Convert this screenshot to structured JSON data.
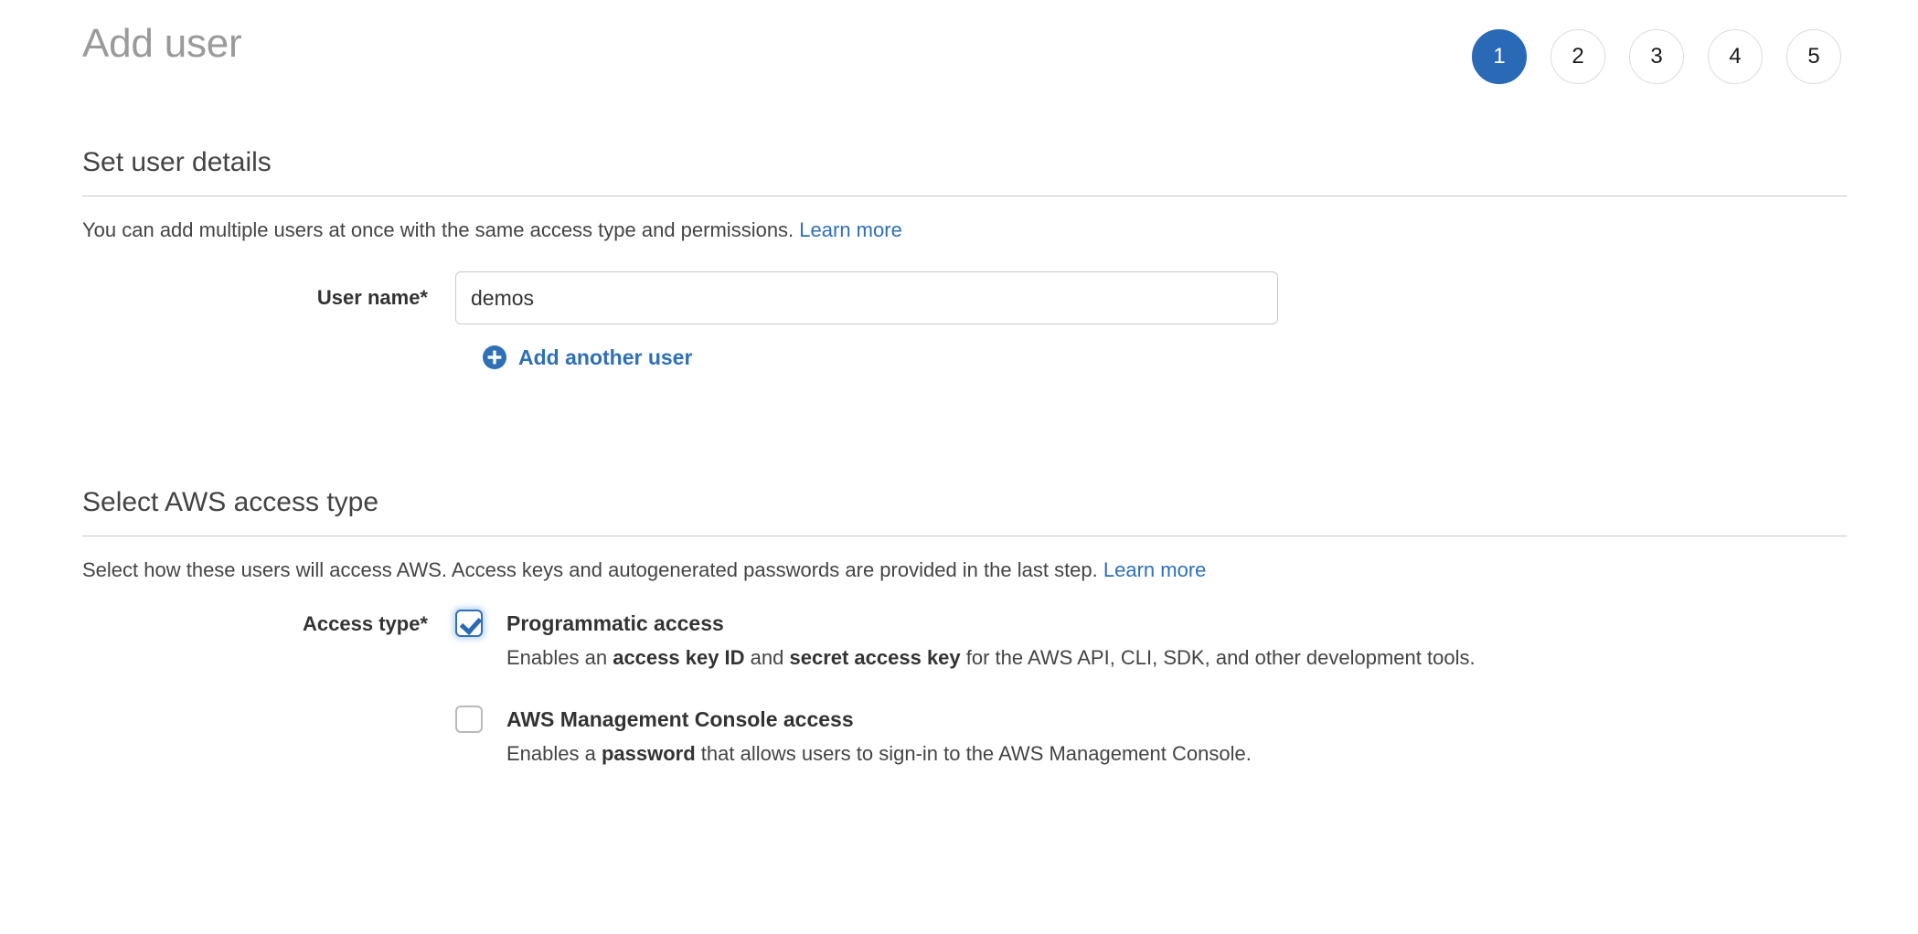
{
  "header": {
    "title": "Add user",
    "steps": [
      {
        "label": "1",
        "active": true
      },
      {
        "label": "2",
        "active": false
      },
      {
        "label": "3",
        "active": false
      },
      {
        "label": "4",
        "active": false
      },
      {
        "label": "5",
        "active": false
      }
    ]
  },
  "colors": {
    "accent_blue": "#2a69b5",
    "link_blue": "#2f6fb5",
    "title_gray": "#9a9a9a",
    "text": "#333333",
    "divider": "#c8c8c8",
    "input_border": "#c9c9c9",
    "checkbox_border": "#b9b9b9"
  },
  "user_details": {
    "section_title": "Set user details",
    "description_text": "You can add multiple users at once with the same access type and permissions.",
    "description_link": "Learn more",
    "username_label": "User name*",
    "username_value": "demos",
    "username_placeholder": "",
    "add_another_user_label": "Add another user",
    "plus_icon": "plus-circle-icon"
  },
  "access_type": {
    "section_title": "Select AWS access type",
    "description_text": "Select how these users will access AWS. Access keys and autogenerated passwords are provided in the last step.",
    "description_link": "Learn more",
    "access_type_label": "Access type*",
    "options": [
      {
        "id": "programmatic-access",
        "checked": true,
        "title": "Programmatic access",
        "desc_part1": "Enables an ",
        "desc_bold1": "access key ID",
        "desc_part2": " and ",
        "desc_bold2": "secret access key",
        "desc_part3": " for the AWS API, CLI, SDK, and other development tools."
      },
      {
        "id": "console-access",
        "checked": false,
        "title": "AWS Management Console access",
        "desc_part1": "Enables a ",
        "desc_bold1": "password",
        "desc_part2": " that allows users to sign-in to the AWS Management Console.",
        "desc_bold2": "",
        "desc_part3": ""
      }
    ]
  }
}
